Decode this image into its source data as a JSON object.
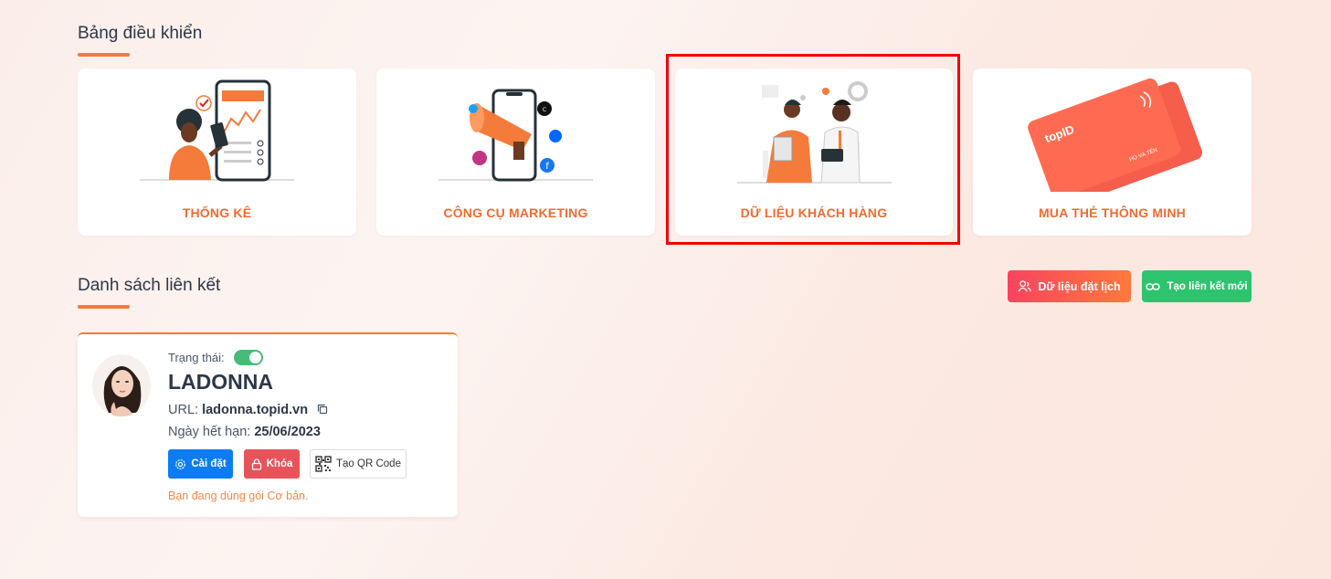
{
  "dashboard": {
    "title": "Bảng điều khiển",
    "cards": [
      {
        "label": "THỐNG KÊ",
        "icon": "statistics-illustration"
      },
      {
        "label": "CÔNG CỤ MARKETING",
        "icon": "marketing-illustration"
      },
      {
        "label": "DỮ LIỆU KHÁCH HÀNG",
        "icon": "customer-data-illustration"
      },
      {
        "label": "MUA THẺ THÔNG MINH",
        "icon": "smart-card-illustration"
      }
    ]
  },
  "links": {
    "title": "Danh sách liên kết",
    "booking_button": "Dữ liệu đặt lịch",
    "new_link_button": "Tạo liên kết mới"
  },
  "profile": {
    "status_label": "Trạng thái:",
    "status_on": true,
    "name": "LADONNA",
    "url_label": "URL:",
    "url": "ladonna.topid.vn",
    "expiry_label": "Ngày hết hạn:",
    "expiry": "25/06/2023",
    "settings_button": "Cài đặt",
    "lock_button": "Khóa",
    "qr_button": "Tạo QR Code",
    "plan_note": "Bạn đang dùng gói Cơ bản."
  },
  "card_text": {
    "brand": "topID",
    "holder": "HỌ VÀ TÊN"
  },
  "colors": {
    "accent": "#f26b2f",
    "highlight": "#f30000",
    "green": "#2ec46f",
    "blue": "#0d7cf2",
    "red": "#e8535a"
  }
}
